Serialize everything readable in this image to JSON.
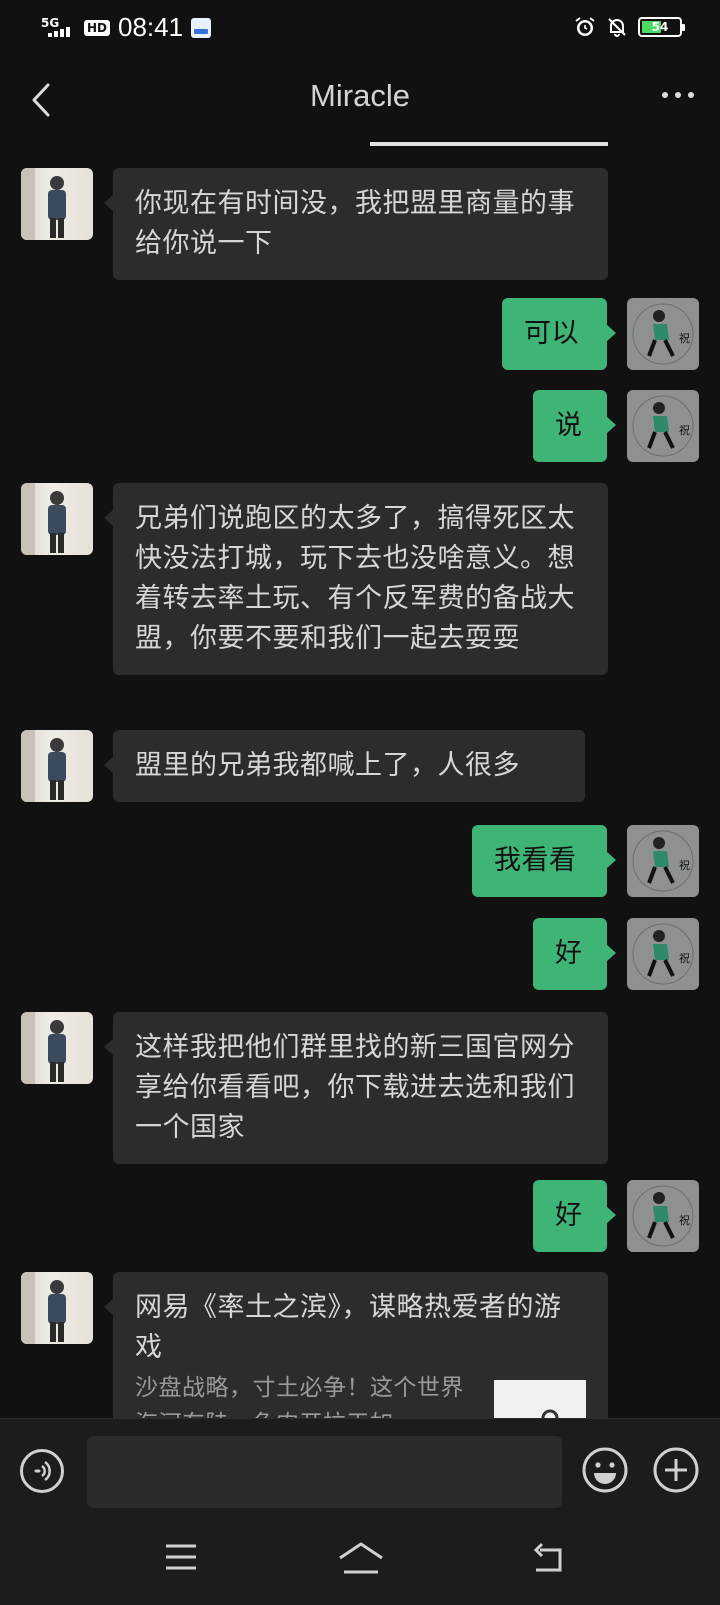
{
  "status_bar": {
    "network": "5G",
    "hd": "HD",
    "time": "08:41",
    "battery": "54",
    "battery_level": 0.54
  },
  "header": {
    "title": "Miracle"
  },
  "messages": [
    {
      "from": "friend",
      "text": "你现在有时间没，我把盟里商量的事给你说一下"
    },
    {
      "from": "self",
      "text": "可以"
    },
    {
      "from": "self",
      "text": "说"
    },
    {
      "from": "friend",
      "text": "兄弟们说跑区的太多了，搞得死区太快没法打城，玩下去也没啥意义。想着转去率土玩、有个反军费的备战大盟，你要不要和我们一起去耍耍"
    },
    {
      "from": "friend",
      "text": "盟里的兄弟我都喊上了，人很多"
    },
    {
      "from": "self",
      "text": "我看看"
    },
    {
      "from": "self",
      "text": "好"
    },
    {
      "from": "friend",
      "text": "这样我把他们群里找的新三国官网分享给你看看吧，你下载进去选和我们一个国家"
    },
    {
      "from": "self",
      "text": "好"
    },
    {
      "from": "friend",
      "type": "card",
      "title": "网易《率土之滨》，谋略热爱者的游戏",
      "desc": "沙盘战略，寸土必争！这个世界海河东陆，鱼肉开拉天如"
    }
  ],
  "self_avatar_char": "祝",
  "colors": {
    "background": "#111111",
    "bubble_in": "#2c2c2c",
    "bubble_out": "#3eb577"
  },
  "icons": {
    "back": "chevron-left-icon",
    "more": "more-dots-icon",
    "voice": "voice-icon",
    "emoji": "emoji-icon",
    "plus": "plus-icon"
  }
}
